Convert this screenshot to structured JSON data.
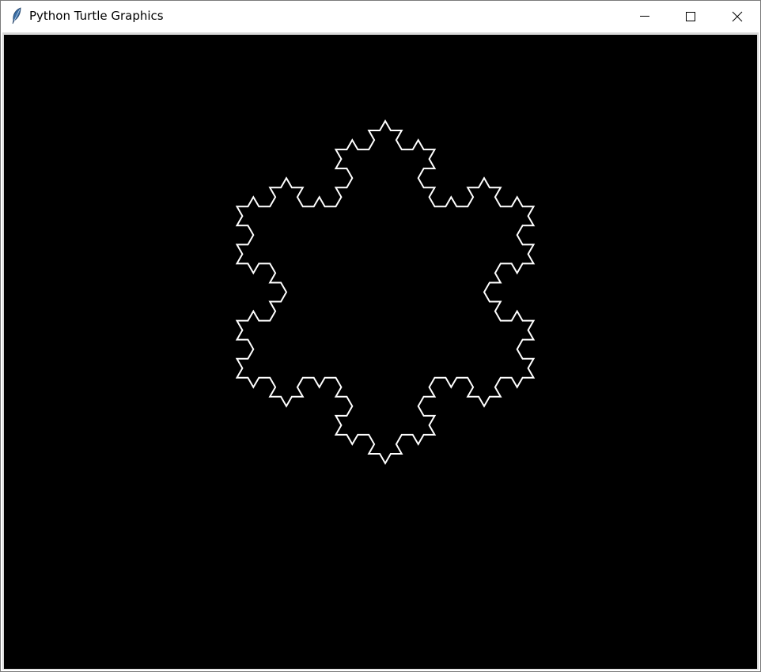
{
  "window": {
    "title": "Python Turtle Graphics",
    "app_icon": "feather-icon",
    "controls": [
      "minimize-icon",
      "maximize-icon",
      "close-icon"
    ]
  },
  "canvas": {
    "background_color": "#000000",
    "pen_color": "#ffffff",
    "drawing": "koch-snowflake",
    "recursion_depth": 3
  }
}
